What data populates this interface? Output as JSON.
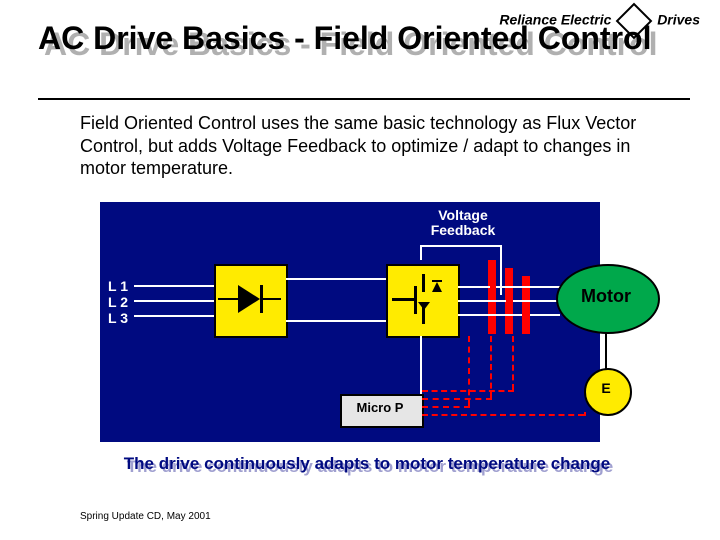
{
  "brand": {
    "left": "Reliance Electric",
    "right": "Drives"
  },
  "title": "AC Drive Basics - Field Oriented Control",
  "body": "Field Oriented Control uses the same basic technology as Flux Vector Control, but adds Voltage Feedback to optimize / adapt to changes in motor temperature.",
  "diagram": {
    "voltage_feedback": "Voltage\nFeedback",
    "input_lines": [
      "L 1",
      "L 2",
      "L 3"
    ],
    "micro_p": "Micro P",
    "motor": "Motor",
    "encoder": "E"
  },
  "caption": "The drive continuously adapts to motor temperature change",
  "footer": "Spring Update CD, May 2001",
  "colors": {
    "diagram_bg": "#000a80",
    "block_yellow": "#ffeb00",
    "motor_green": "#00a84b",
    "feedback_red": "#f00"
  }
}
